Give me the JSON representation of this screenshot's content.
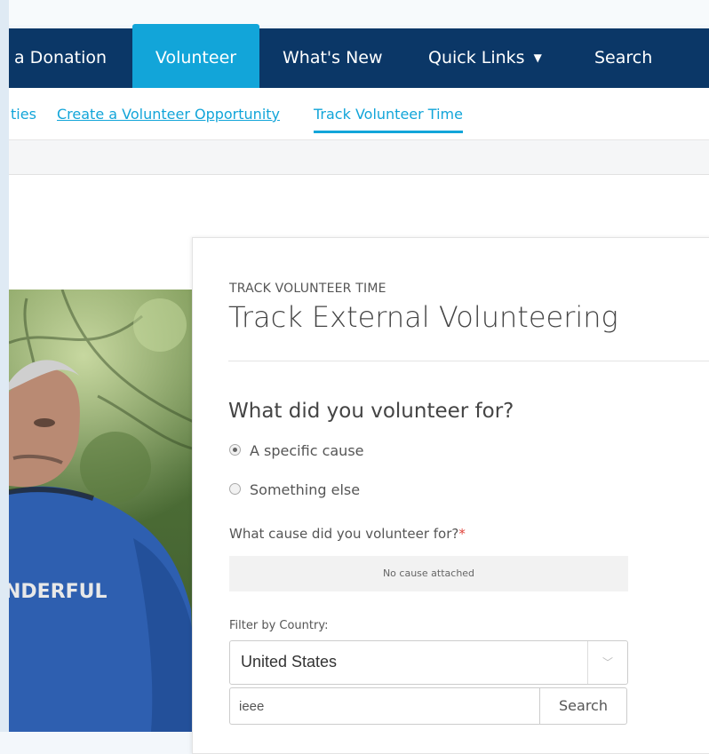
{
  "nav": {
    "items": [
      {
        "label": "a Donation"
      },
      {
        "label": "Volunteer"
      },
      {
        "label": "What's New"
      },
      {
        "label": "Quick Links"
      },
      {
        "label": "Search"
      }
    ],
    "caret": "▼"
  },
  "subnav": {
    "items": [
      {
        "label": "ties"
      },
      {
        "label": "Create a Volunteer Opportunity"
      },
      {
        "label": "Track Volunteer Time"
      }
    ]
  },
  "photo": {
    "shirt_text": "NDERFUL"
  },
  "form": {
    "eyebrow": "TRACK VOLUNTEER TIME",
    "title": "Track External Volunteering",
    "question": "What did you volunteer for?",
    "options": [
      {
        "label": "A specific cause",
        "selected": true
      },
      {
        "label": "Something else",
        "selected": false
      }
    ],
    "cause_label": "What cause did you volunteer for?",
    "required_marker": "*",
    "cause_value": "No cause attached",
    "filter_label": "Filter by Country:",
    "country": "United States",
    "search_value": "ieee",
    "search_button": "Search"
  },
  "colors": {
    "nav_bg": "#0b3767",
    "accent": "#12a5d9",
    "required": "#e0433a"
  }
}
